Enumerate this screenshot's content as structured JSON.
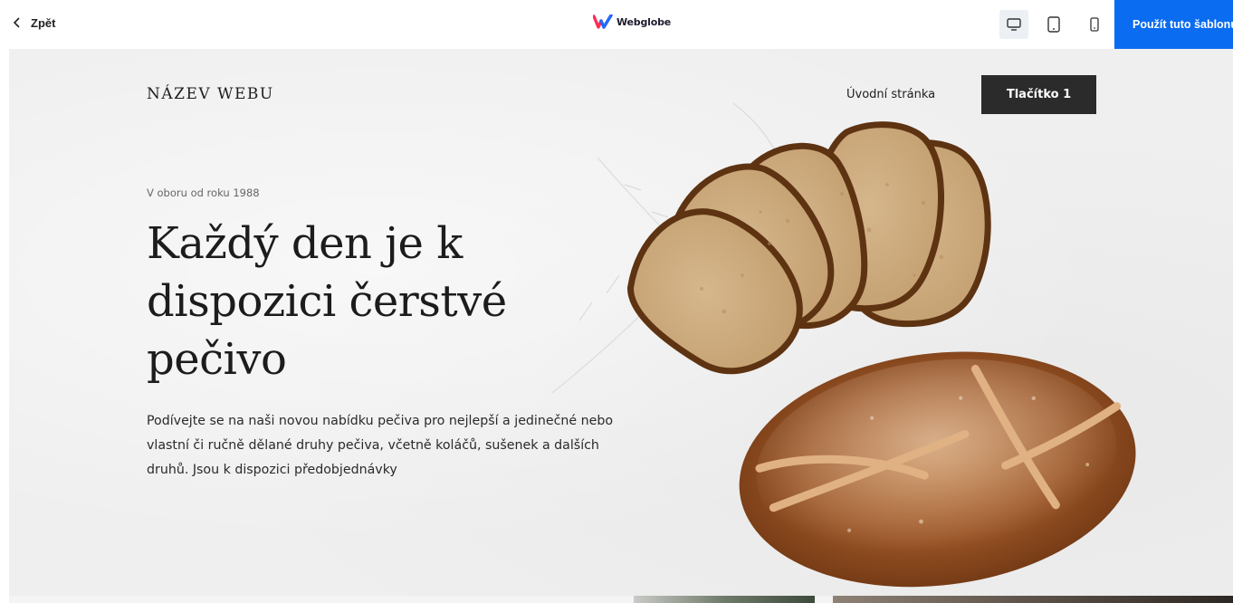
{
  "topbar": {
    "back_label": "Zpět",
    "brand": "Webglobe",
    "use_template_label": "Použít tuto šablonu",
    "devices": [
      "desktop-icon",
      "tablet-icon",
      "mobile-icon"
    ],
    "active_device": "desktop",
    "accent_color": "#0a6cf0"
  },
  "site": {
    "name": "NÁZEV WEBU",
    "nav": {
      "home": "Úvodní stránka",
      "button": "Tlačítko 1"
    },
    "hero": {
      "eyebrow": "V oboru od roku 1988",
      "headline": "Každý den je k dispozici čerstvé pečivo",
      "lead": "Podívejte se na naši novou nabídku pečiva pro nejlepší a jedinečné nebo vlastní či ručně dělané druhy pečiva, včetně koláčů, sušenek a dalších druhů. Jsou k dispozici předobjednávky",
      "image": "bread-loaf-and-slices-image"
    }
  }
}
